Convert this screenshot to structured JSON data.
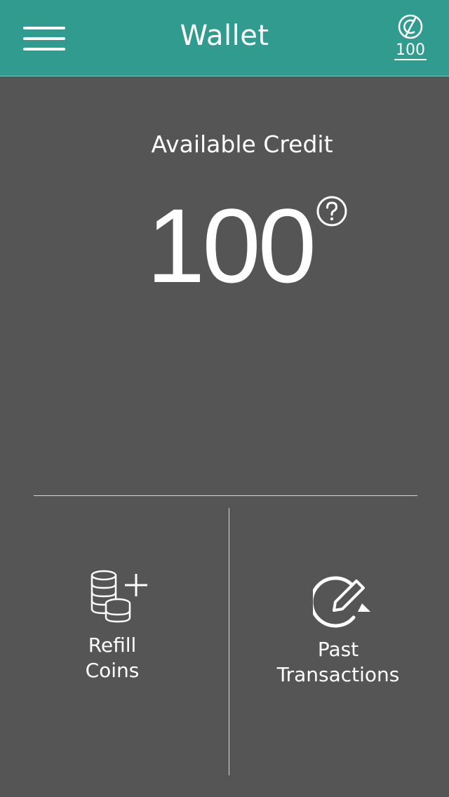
{
  "header": {
    "title": "Wallet",
    "menu_icon": "hamburger-menu-icon",
    "balance_icon": "coin-currency-icon",
    "balance_value": "100"
  },
  "main": {
    "available_label": "Available Credit",
    "credit_value": "100",
    "help_icon": "question-circle-icon"
  },
  "actions": [
    {
      "label_line1": "Refill",
      "label_line2": "Coins",
      "icon": "coins-plus-icon"
    },
    {
      "label_line1": "Past",
      "label_line2": "Transactions",
      "icon": "edit-history-icon"
    }
  ],
  "colors": {
    "header_bg": "#319b90",
    "body_bg": "#555555",
    "text": "#ffffff"
  }
}
